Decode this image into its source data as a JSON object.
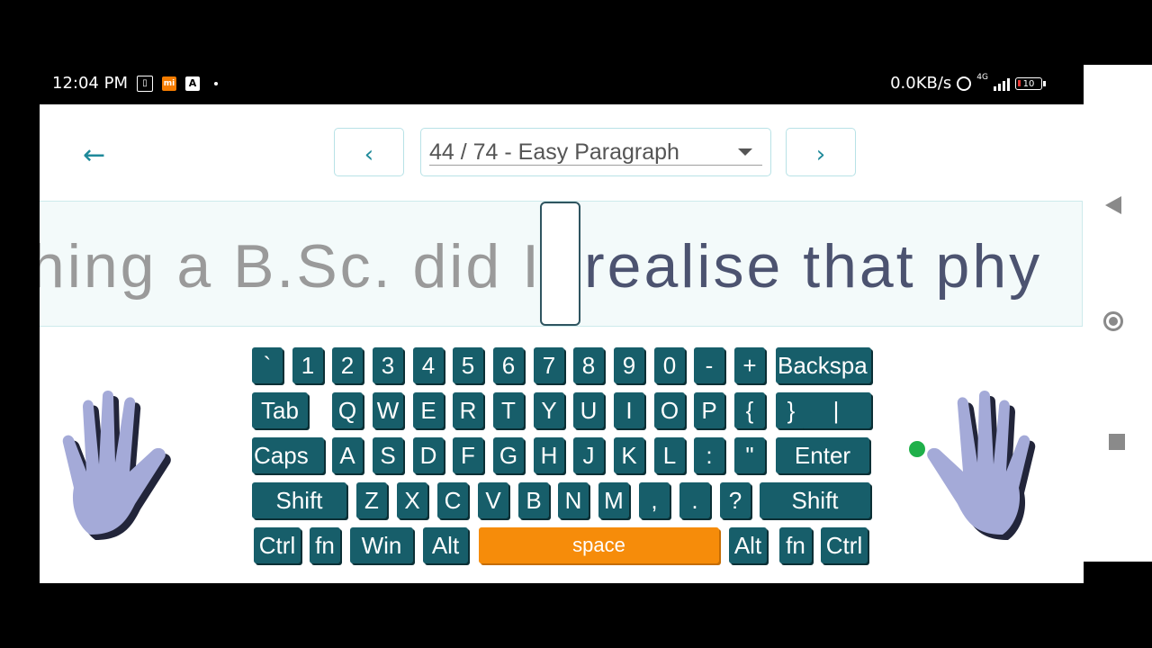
{
  "status_bar": {
    "time": "12:04 PM",
    "notif_a": "A",
    "net_speed": "0.0KB/s",
    "network": "4G",
    "battery": "10"
  },
  "header": {
    "prev_label": "‹",
    "next_label": "›",
    "lesson_selected": "44 / 74 - Easy Paragraph"
  },
  "practice": {
    "typed": "hing a B.Sc. did I",
    "upcoming": "realise that phy"
  },
  "keyboard": {
    "rows": [
      [
        "`",
        "1",
        "2",
        "3",
        "4",
        "5",
        "6",
        "7",
        "8",
        "9",
        "0",
        "-",
        "+",
        "Backspa"
      ],
      [
        "Tab",
        "Q",
        "W",
        "E",
        "R",
        "T",
        "Y",
        "U",
        "I",
        "O",
        "P",
        "{",
        "}",
        "|"
      ],
      [
        "Caps",
        "A",
        "S",
        "D",
        "F",
        "G",
        "H",
        "J",
        "K",
        "L",
        ":",
        "\"",
        "Enter"
      ],
      [
        "Shift",
        "Z",
        "X",
        "C",
        "V",
        "B",
        "N",
        "M",
        ",",
        ".",
        "?",
        "Shift"
      ],
      [
        "Ctrl",
        "fn",
        "Win",
        "Alt",
        "space",
        "Alt",
        "fn",
        "Ctrl"
      ]
    ]
  },
  "colors": {
    "key": "#175e6a",
    "space_key": "#f68c0a",
    "accent": "#1f8a9a",
    "hand": "#a4aad8",
    "finger_dot": "#1fb04a"
  }
}
